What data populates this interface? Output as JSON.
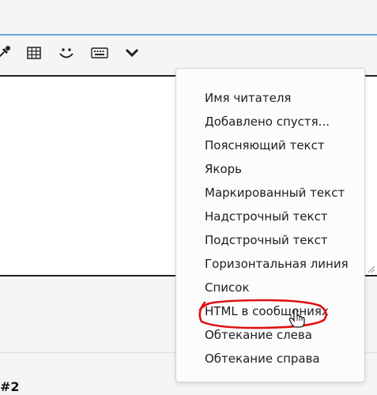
{
  "toolbar": {
    "buttons": [
      {
        "name": "color-picker",
        "icon": "eyedropper-icon"
      },
      {
        "name": "table",
        "icon": "table-icon"
      },
      {
        "name": "smilies",
        "icon": "smiley-icon"
      },
      {
        "name": "keyboard",
        "icon": "keyboard-icon"
      },
      {
        "name": "more",
        "icon": "chevron-down-icon"
      }
    ]
  },
  "dropdown": {
    "items": [
      {
        "label": "Имя читателя"
      },
      {
        "label": "Добавлено спустя..."
      },
      {
        "label": "Поясняющий текст"
      },
      {
        "label": "Якорь"
      },
      {
        "label": "Маркированный текст"
      },
      {
        "label": "Надстрочный текст"
      },
      {
        "label": "Подстрочный текст"
      },
      {
        "label": "Горизонтальная линия"
      },
      {
        "label": "Список"
      },
      {
        "label": "HTML в сообщениях"
      },
      {
        "label": "Обтекание слева"
      },
      {
        "label": "Обтекание справа"
      }
    ],
    "highlighted_index": 9,
    "highlight_color": "#e01010"
  },
  "post": {
    "number_label": "#2"
  },
  "colors": {
    "accent_border": "#66a3dd",
    "editor_bg": "#ffffff",
    "page_bg": "#f5f5f5"
  }
}
